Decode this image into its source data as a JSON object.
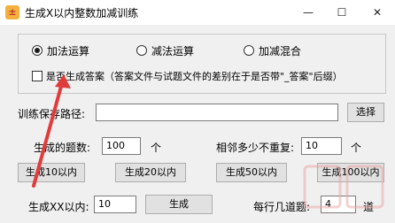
{
  "window": {
    "title": "生成X以内整数加减训练",
    "icon_glyph": "±",
    "minimize": "—",
    "maximize": "☐",
    "close": "✕"
  },
  "mode": {
    "add_label": "加法运算",
    "sub_label": "减法运算",
    "mixed_label": "加减混合",
    "selected": "add_label"
  },
  "answer_option": {
    "label": "是否生成答案（答案文件与试题文件的差别在于是否带\"_答案\"后缀）",
    "checked": false
  },
  "save_path": {
    "label": "训练保存路径:",
    "value": "",
    "browse_button": "选择"
  },
  "count": {
    "label": "生成的题数:",
    "value": "100",
    "unit": "个"
  },
  "no_repeat": {
    "label": "相邻多少不重复:",
    "value": "10",
    "unit": "个"
  },
  "quick_buttons": [
    "生成10以内",
    "生成20以内",
    "生成50以内",
    "生成100以内"
  ],
  "custom": {
    "label": "生成XX以内:",
    "value": "10",
    "generate_button": "生成"
  },
  "per_line": {
    "label": "每行几道题:",
    "value": "4",
    "unit": "道"
  },
  "colors": {
    "annotation_arrow": "#e23b3b",
    "watermark": "#e8a3a3"
  }
}
